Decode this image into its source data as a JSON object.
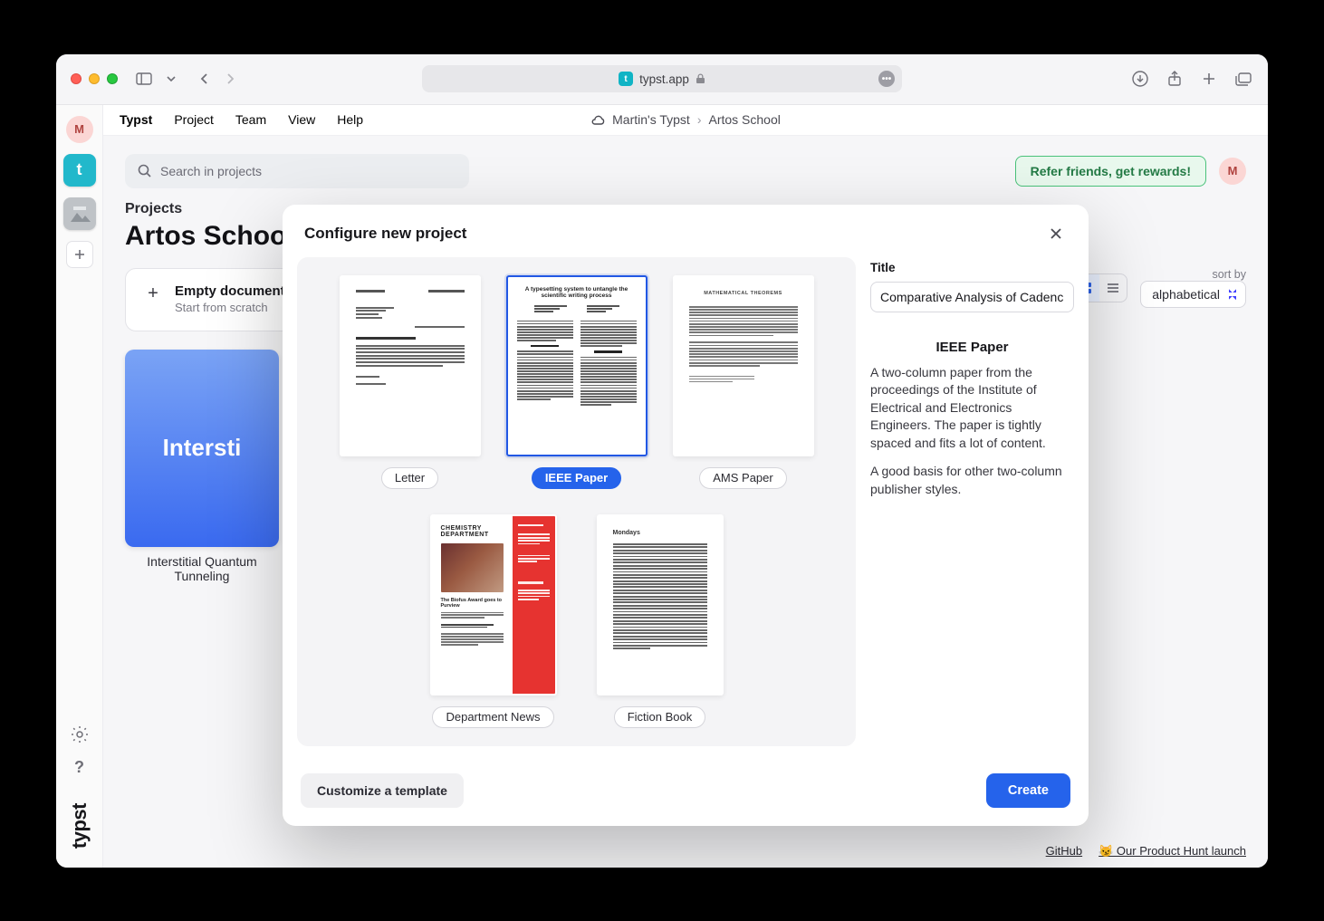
{
  "browser": {
    "url_host": "typst.app",
    "favicon_letter": "t"
  },
  "menubar": {
    "brand": "Typst",
    "items": [
      "Project",
      "Team",
      "View",
      "Help"
    ]
  },
  "breadcrumb": {
    "workspace": "Martin's Typst",
    "project": "Artos School"
  },
  "rail": {
    "user_initial": "M",
    "tiles": [
      {
        "kind": "letter",
        "label": "t"
      },
      {
        "kind": "image"
      }
    ]
  },
  "topbar": {
    "search_placeholder": "Search in projects",
    "refer_label": "Refer friends, get rewards!",
    "user_initial": "M"
  },
  "projects": {
    "label": "Projects",
    "heading": "Artos School",
    "empty_card": {
      "title": "Empty document",
      "subtitle": "Start from scratch"
    },
    "sort_label": "sort by",
    "sort_value": "alphabetical",
    "card1": {
      "thumb_text": "Intersti",
      "caption": "Interstitial Quantum Tunneling"
    }
  },
  "footer": {
    "github": "GitHub",
    "ph": "😼 Our Product Hunt launch"
  },
  "modal": {
    "title": "Configure new project",
    "templates": [
      {
        "id": "letter",
        "name": "Letter",
        "selected": false
      },
      {
        "id": "ieee",
        "name": "IEEE Paper",
        "selected": true
      },
      {
        "id": "ams",
        "name": "AMS Paper",
        "selected": false
      },
      {
        "id": "dept",
        "name": "Department News",
        "selected": false
      },
      {
        "id": "fiction",
        "name": "Fiction Book",
        "selected": false
      }
    ],
    "title_label": "Title",
    "title_value": "Comparative Analysis of Cadence-Driven Typesetting",
    "detail_name": "IEEE Paper",
    "detail_desc1": "A two-column paper from the proceedings of the Institute of Electrical and Electronics Engineers. The paper is tightly spaced and fits a lot of content.",
    "detail_desc2": "A good basis for other two-column publisher styles.",
    "customize_label": "Customize a template",
    "create_label": "Create",
    "doc_ieee_title": "A typesetting system to untangle the scientific writing process",
    "doc_ams_title": "MATHEMATICAL THEOREMS",
    "doc_dept_header": "CHEMISTRY DEPARTMENT",
    "doc_dept_sub": "The Biofus Award goes to Purview",
    "doc_fiction_header": "Mondays"
  }
}
